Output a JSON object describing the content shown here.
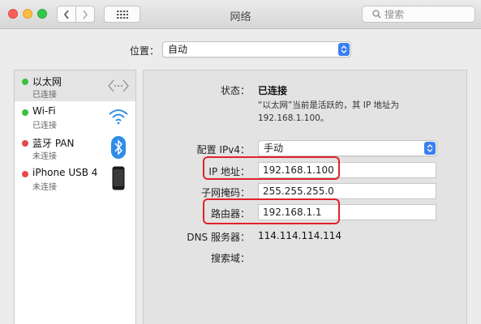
{
  "window": {
    "title": "网络",
    "search_placeholder": "搜索"
  },
  "location": {
    "label": "位置：",
    "value": "自动"
  },
  "services": [
    {
      "name": "以太网",
      "status": "已连接",
      "status_color": "#3bbf3f",
      "icon": "ethernet-icon",
      "selected": true
    },
    {
      "name": "Wi-Fi",
      "status": "已连接",
      "status_color": "#3bbf3f",
      "icon": "wifi-icon"
    },
    {
      "name": "蓝牙 PAN",
      "status": "未连接",
      "status_color": "#e8484a",
      "icon": "bluetooth-icon"
    },
    {
      "name": "iPhone USB 4",
      "status": "未连接",
      "status_color": "#e8484a",
      "icon": "iphone-icon"
    }
  ],
  "detail": {
    "status_label": "状态：",
    "status_value": "已连接",
    "status_desc_line1": "“以太网”当前是活跃的，其 IP 地址为",
    "status_desc_line2": "192.168.1.100。",
    "ipv4_label": "配置 IPv4：",
    "ipv4_value": "手动",
    "ip_label": "IP 地址：",
    "ip_value": "192.168.1.100",
    "mask_label": "子网掩码：",
    "mask_value": "255.255.255.0",
    "router_label": "路由器：",
    "router_value": "192.168.1.1",
    "dns_label": "DNS 服务器：",
    "dns_value": "114.114.114.114",
    "search_domain_label": "搜索域："
  },
  "colors": {
    "accent": "#3a7ff0",
    "highlight": "#e1212b"
  }
}
